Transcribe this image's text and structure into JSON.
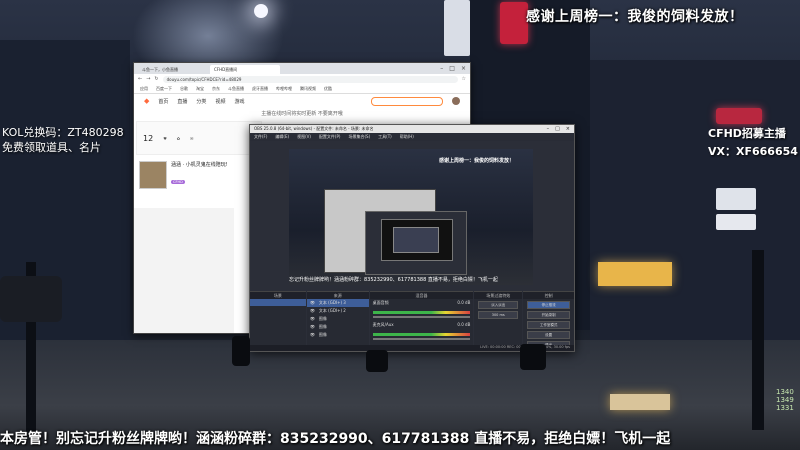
{
  "overlay": {
    "top_banner": "感谢上周榜一：我俊的饲料发放！",
    "kol_line1": "KOL兑换码：ZT480298",
    "kol_line2": "免费领取道具、名片",
    "right_line1": "CFHD招募主播",
    "right_line2": "VX：XF666654",
    "ticker": "本房管！别忘记升粉丝牌牌哟！涵涵粉碎群：835232990、617781388  直播不易，拒绝白嫖！飞机一起",
    "side_numbers": [
      "1340",
      "1349",
      "1331"
    ]
  },
  "browser": {
    "tabs": [
      "斗鱼一下，小鱼直播",
      "CFHD直播间"
    ],
    "url": "douyu.com/topic/CFHDCE?rid=48029",
    "bookmarks": [
      "应用",
      "百度一下",
      "谷歌",
      "淘宝",
      "京东",
      "斗鱼直播",
      "虎牙直播",
      "哔哩哔哩",
      "腾讯视频",
      "优酷"
    ],
    "site_nav": [
      "首页",
      "直播",
      "分类",
      "视频",
      "游戏"
    ],
    "notice": "主播在线时间将实时更新 不要离开哦",
    "panel_number": "12",
    "streamer_name": "涵涵 · 小机灵鬼在线陪玩!",
    "badge": "CFHD"
  },
  "obs": {
    "title": "OBS 25.0.8 (64-bit, windows) - 配置文件: 未命名 - 场景: 未命名",
    "menu": [
      "文件(F)",
      "编辑(E)",
      "视图(V)",
      "配置文件(P)",
      "场景集合(S)",
      "工具(T)",
      "帮助(H)"
    ],
    "preview_text": "感谢上周榜一：我俊的饲料发放！",
    "preview_ticker": "忘记升粉丝牌牌哟！涵涵粉碎群：835232990、617781388  直播不易，拒绝白嫖！飞机一起",
    "docks": {
      "scenes": "场景",
      "sources": "来源",
      "mixer": "混音器",
      "transitions": "场景过渡特效",
      "controls": "控制"
    },
    "sources_list": [
      "文本 (GDI+) 3",
      "文本 (GDI+) 2",
      "图像",
      "图像",
      "图像"
    ],
    "mixer_channels": [
      "桌面音频",
      "麦克风/Aux"
    ],
    "mixer_db": [
      "0.0 dB",
      "0.0 dB"
    ],
    "transition_type": "淡入淡出",
    "transition_duration": "300 ms",
    "controls_buttons": [
      "停止推流",
      "开始录制",
      "工作室模式",
      "设置",
      "退出"
    ],
    "status": "LIVE: 00:00:00  REC: 00:00:00  CPU: 3.4%, 30.00 fps"
  }
}
